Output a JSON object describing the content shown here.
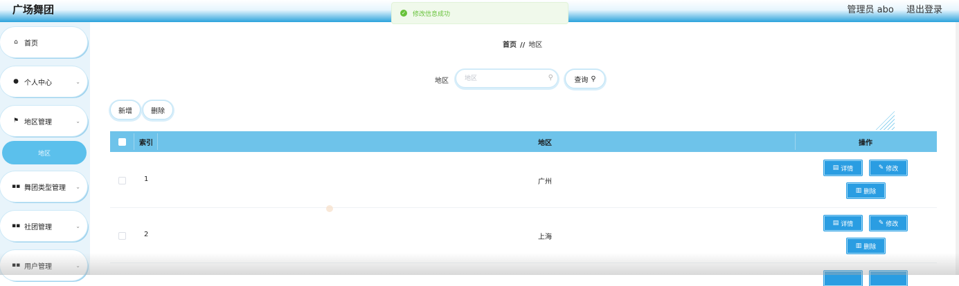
{
  "app": {
    "title": "广场舞团"
  },
  "header": {
    "user_label": "管理员 abo",
    "logout_label": "退出登录"
  },
  "toast": {
    "message": "修改信息成功",
    "icon": "check-circle-icon",
    "color": "#67c23a"
  },
  "sidebar": {
    "items": [
      {
        "label": "首页",
        "icon": "home-icon",
        "expandable": false
      },
      {
        "label": "个人中心",
        "icon": "user-icon",
        "expandable": true
      },
      {
        "label": "地区管理",
        "icon": "flag-icon",
        "expandable": true
      },
      {
        "label": "舞团类型管理",
        "icon": "grid-icon",
        "expandable": true
      },
      {
        "label": "社团管理",
        "icon": "grid-icon",
        "expandable": true
      },
      {
        "label": "用户管理",
        "icon": "grid-icon",
        "expandable": true
      }
    ],
    "active_subitem": "地区"
  },
  "breadcrumb": {
    "home": "首页",
    "separator": "//",
    "current": "地区"
  },
  "search": {
    "label": "地区",
    "placeholder": "地区",
    "value": "",
    "button_label": "查询"
  },
  "toolbar": {
    "add_label": "新增",
    "delete_label": "删除"
  },
  "table": {
    "columns": [
      "索引",
      "地区",
      "操作"
    ],
    "rows": [
      {
        "index": "1",
        "region": "广州"
      },
      {
        "index": "2",
        "region": "上海"
      }
    ],
    "actions": {
      "detail": "详情",
      "edit": "修改",
      "delete": "删除"
    }
  },
  "colors": {
    "accent": "#2a9de2",
    "header_bg": "#6ec3ea",
    "sidebar_active": "#5bc0ec"
  }
}
